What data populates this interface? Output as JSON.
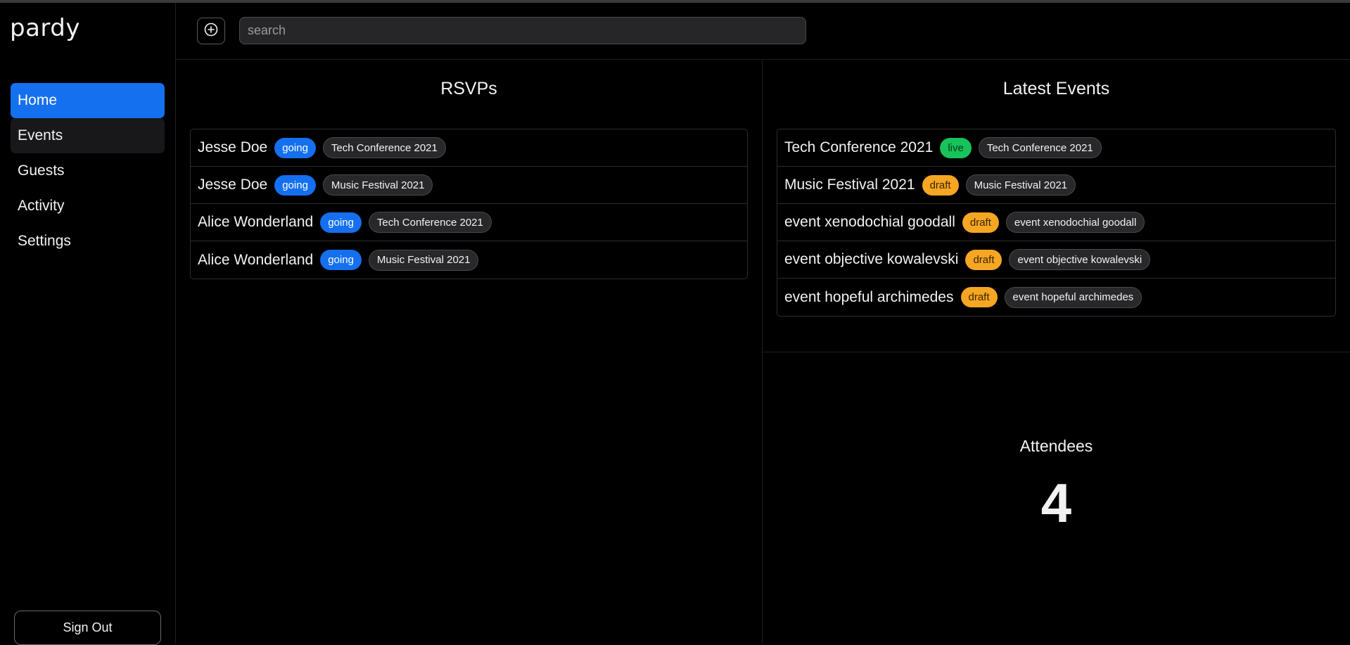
{
  "app": {
    "logo_text": "pardy"
  },
  "sidebar": {
    "items": [
      {
        "label": "Home",
        "state": "active"
      },
      {
        "label": "Events",
        "state": "hover"
      },
      {
        "label": "Guests",
        "state": ""
      },
      {
        "label": "Activity",
        "state": ""
      },
      {
        "label": "Settings",
        "state": ""
      }
    ],
    "sign_out_label": "Sign Out"
  },
  "topbar": {
    "add_icon": "plus-circle-icon",
    "search_placeholder": "search",
    "search_value": ""
  },
  "rsvps": {
    "title": "RSVPs",
    "rows": [
      {
        "name": "Jesse Doe",
        "status": "going",
        "event": "Tech Conference 2021"
      },
      {
        "name": "Jesse Doe",
        "status": "going",
        "event": "Music Festival 2021"
      },
      {
        "name": "Alice Wonderland",
        "status": "going",
        "event": "Tech Conference 2021"
      },
      {
        "name": "Alice Wonderland",
        "status": "going",
        "event": "Music Festival 2021"
      }
    ]
  },
  "latest_events": {
    "title": "Latest Events",
    "rows": [
      {
        "name": "Tech Conference 2021",
        "status": "live",
        "tag": "Tech Conference 2021"
      },
      {
        "name": "Music Festival 2021",
        "status": "draft",
        "tag": "Music Festival 2021"
      },
      {
        "name": "event xenodochial goodall",
        "status": "draft",
        "tag": "event xenodochial goodall"
      },
      {
        "name": "event objective kowalevski",
        "status": "draft",
        "tag": "event objective kowalevski"
      },
      {
        "name": "event hopeful archimedes",
        "status": "draft",
        "tag": "event hopeful archimedes"
      }
    ]
  },
  "attendees": {
    "title": "Attendees",
    "count": "4"
  },
  "colors": {
    "accent": "#1570ef",
    "live": "#17c35b",
    "draft": "#f5a623",
    "background": "#000000"
  }
}
